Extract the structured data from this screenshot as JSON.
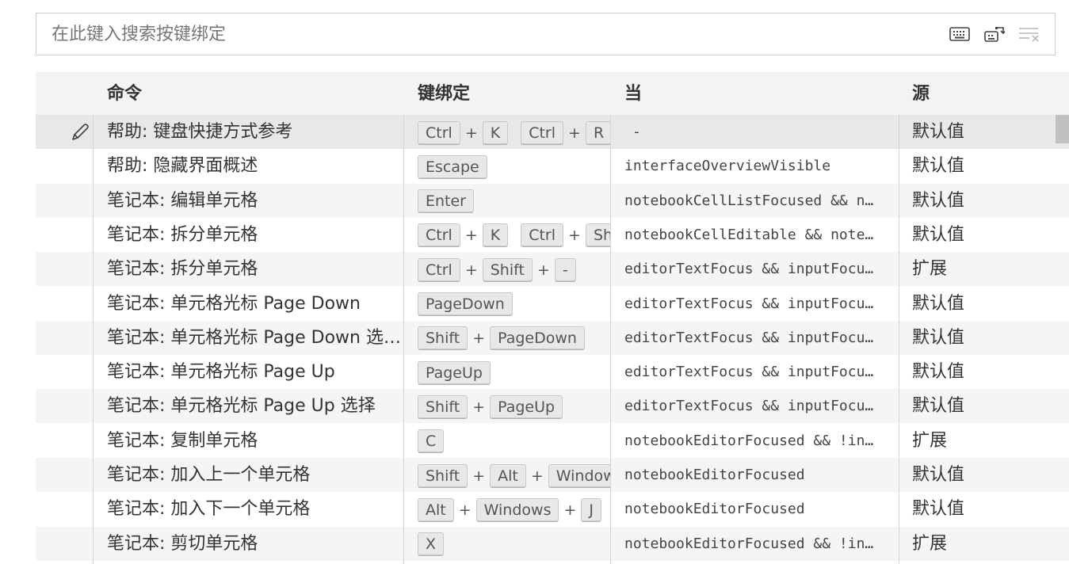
{
  "search": {
    "placeholder": "在此键入搜索按键绑定"
  },
  "toolbar": {
    "record_keys_icon": "keyboard-icon",
    "sort_by_precedence_icon": "sort-precedence-icon",
    "clear_icon": "clear-filter-icon"
  },
  "headers": {
    "command": "命令",
    "keybinding": "键绑定",
    "when": "当",
    "source": "源"
  },
  "rows": [
    {
      "command": "帮助: 键盘快捷方式参考",
      "keys": [
        [
          "Ctrl",
          "K"
        ],
        [
          "Ctrl",
          "R"
        ]
      ],
      "when": "-",
      "source": "默认值",
      "has_edit": true
    },
    {
      "command": "帮助: 隐藏界面概述",
      "keys": [
        [
          "Escape"
        ]
      ],
      "when": "interfaceOverviewVisible",
      "source": "默认值"
    },
    {
      "command": "笔记本: 编辑单元格",
      "keys": [
        [
          "Enter"
        ]
      ],
      "when": "notebookCellListFocused && n…",
      "source": "默认值"
    },
    {
      "command": "笔记本: 拆分单元格",
      "keys": [
        [
          "Ctrl",
          "K"
        ],
        [
          "Ctrl",
          "Shift"
        ]
      ],
      "when": "notebookCellEditable && note…",
      "source": "默认值"
    },
    {
      "command": "笔记本: 拆分单元格",
      "keys": [
        [
          "Ctrl",
          "Shift",
          "-"
        ]
      ],
      "when": "editorTextFocus && inputFocu…",
      "source": "扩展"
    },
    {
      "command": "笔记本: 单元格光标 Page Down",
      "keys": [
        [
          "PageDown"
        ]
      ],
      "when": "editorTextFocus && inputFocu…",
      "source": "默认值"
    },
    {
      "command": "笔记本: 单元格光标 Page Down 选…",
      "keys": [
        [
          "Shift",
          "PageDown"
        ]
      ],
      "when": "editorTextFocus && inputFocu…",
      "source": "默认值"
    },
    {
      "command": "笔记本: 单元格光标 Page Up",
      "keys": [
        [
          "PageUp"
        ]
      ],
      "when": "editorTextFocus && inputFocu…",
      "source": "默认值"
    },
    {
      "command": "笔记本: 单元格光标 Page Up 选择",
      "keys": [
        [
          "Shift",
          "PageUp"
        ]
      ],
      "when": "editorTextFocus && inputFocu…",
      "source": "默认值"
    },
    {
      "command": "笔记本: 复制单元格",
      "keys": [
        [
          "C"
        ]
      ],
      "when": "notebookEditorFocused && !in…",
      "source": "扩展"
    },
    {
      "command": "笔记本: 加入上一个单元格",
      "keys": [
        [
          "Shift",
          "Alt",
          "Windows"
        ]
      ],
      "when": "notebookEditorFocused",
      "source": "默认值"
    },
    {
      "command": "笔记本: 加入下一个单元格",
      "keys": [
        [
          "Alt",
          "Windows",
          "J"
        ]
      ],
      "when": "notebookEditorFocused",
      "source": "默认值"
    },
    {
      "command": "笔记本: 剪切单元格",
      "keys": [
        [
          "X"
        ]
      ],
      "when": "notebookEditorFocused && !in…",
      "source": "扩展"
    }
  ]
}
